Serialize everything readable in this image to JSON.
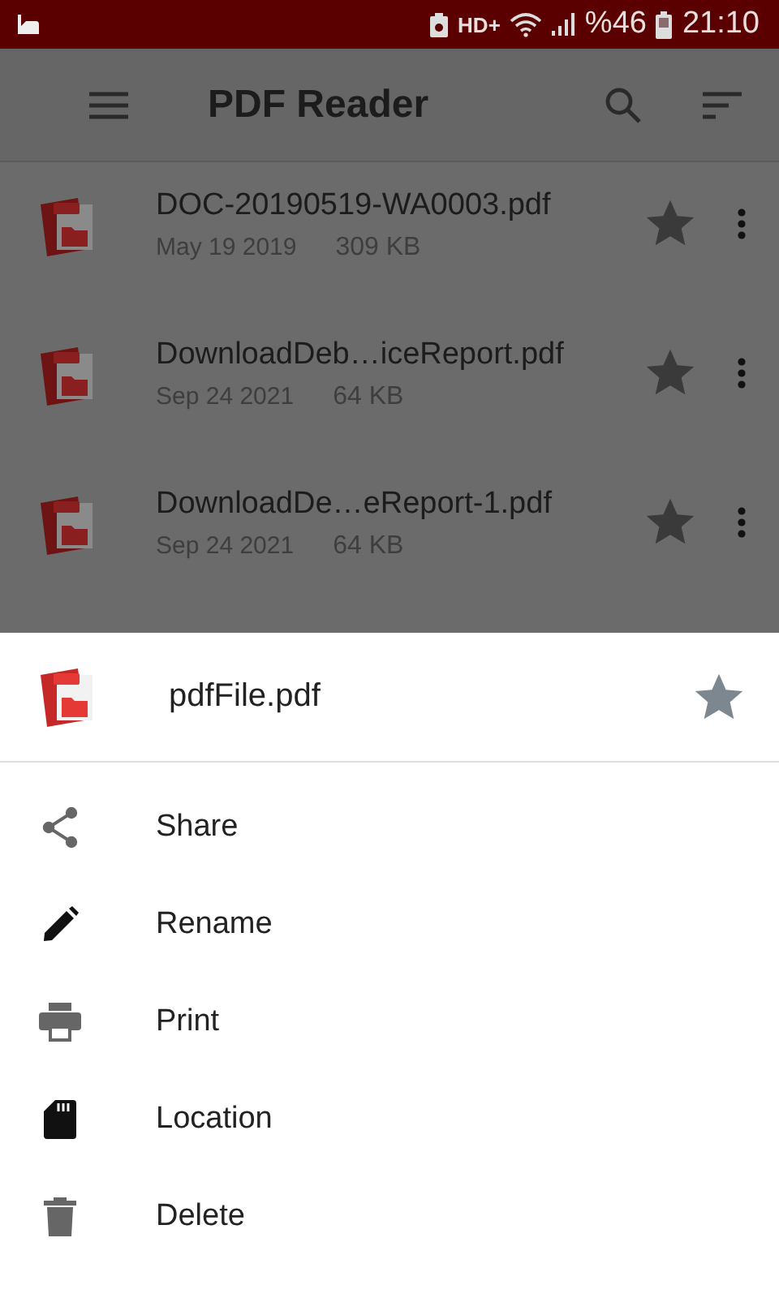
{
  "status_bar": {
    "network": "HD+",
    "battery": "%46",
    "time": "21:10"
  },
  "app_bar": {
    "title": "PDF Reader"
  },
  "files": [
    {
      "name": "DOC-20190519-WA0003.pdf",
      "date": "May 19 2019",
      "size": "309 KB"
    },
    {
      "name": "DownloadDeb…iceReport.pdf",
      "date": "Sep 24 2021",
      "size": "64 KB"
    },
    {
      "name": "DownloadDe…eReport-1.pdf",
      "date": "Sep 24 2021",
      "size": "64 KB"
    }
  ],
  "sheet": {
    "file_name": "pdfFile.pdf",
    "actions": [
      {
        "kind": "share",
        "label": "Share"
      },
      {
        "kind": "rename",
        "label": "Rename"
      },
      {
        "kind": "print",
        "label": "Print"
      },
      {
        "kind": "location",
        "label": "Location"
      },
      {
        "kind": "delete",
        "label": "Delete"
      }
    ]
  }
}
